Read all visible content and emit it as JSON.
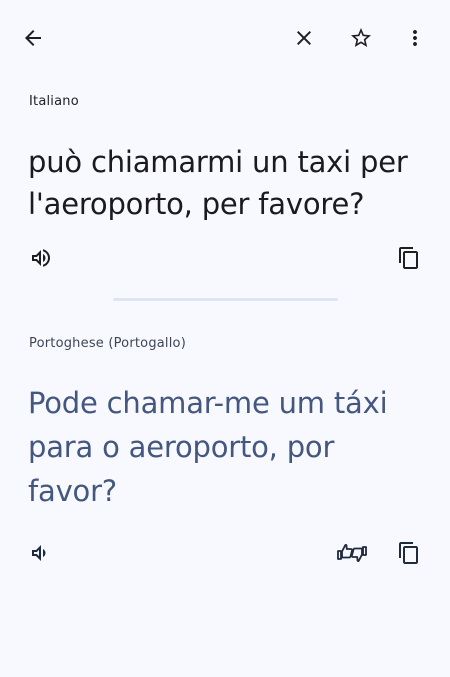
{
  "source": {
    "language": "Italiano",
    "text": "può chiamarmi un taxi per l'aeroporto, per favore?"
  },
  "target": {
    "language": "Portoghese (Portogallo)",
    "text": "Pode chamar-me um táxi para o aeroporto, por favor?"
  },
  "icons": {
    "back": "arrow-back-icon",
    "close": "close-icon",
    "star": "star-outline-icon",
    "more": "more-vert-icon",
    "speak": "volume-up-icon",
    "copy": "copy-icon",
    "feedback": "thumbs-up-down-icon"
  },
  "colors": {
    "background": "#f8f9fe",
    "source_text": "#1b1b1f",
    "target_text": "#44577e",
    "divider": "#dfe4f5"
  }
}
